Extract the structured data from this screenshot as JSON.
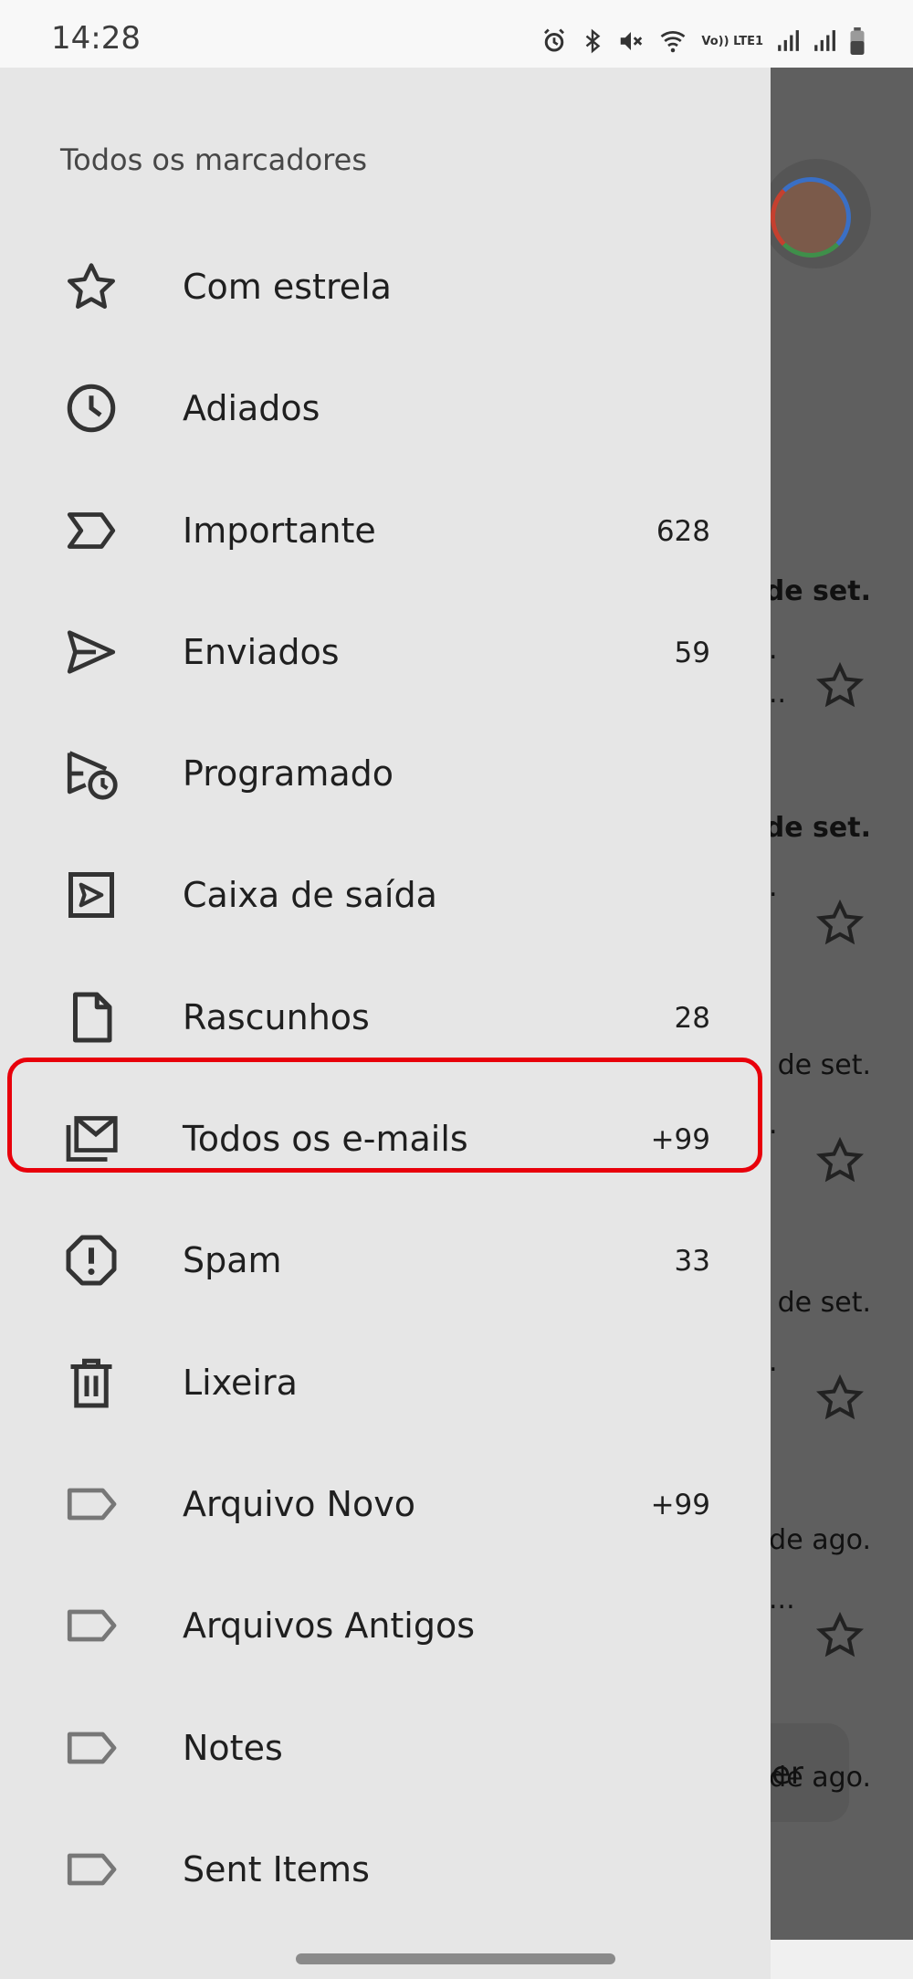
{
  "status_bar": {
    "time": "14:28",
    "icons": [
      "alarm-icon",
      "bluetooth-icon",
      "mute-icon",
      "wifi-icon",
      "volte-icon",
      "signal-icon",
      "signal-r-icon",
      "battery-icon"
    ],
    "volte_label": "Vo)) LTE1"
  },
  "drawer": {
    "heading": "Todos os marcadores",
    "items": [
      {
        "label": "Com estrela",
        "count": "",
        "icon": "star-icon"
      },
      {
        "label": "Adiados",
        "count": "",
        "icon": "clock-icon"
      },
      {
        "label": "Importante",
        "count": "628",
        "icon": "important-icon"
      },
      {
        "label": "Enviados",
        "count": "59",
        "icon": "send-icon"
      },
      {
        "label": "Programado",
        "count": "",
        "icon": "scheduled-send-icon"
      },
      {
        "label": "Caixa de saída",
        "count": "",
        "icon": "outbox-icon"
      },
      {
        "label": "Rascunhos",
        "count": "28",
        "icon": "draft-icon"
      },
      {
        "label": "Todos os e-mails",
        "count": "+99",
        "icon": "all-mail-icon"
      },
      {
        "label": "Spam",
        "count": "33",
        "icon": "spam-icon"
      },
      {
        "label": "Lixeira",
        "count": "",
        "icon": "trash-icon"
      },
      {
        "label": "Arquivo Novo",
        "count": "+99",
        "icon": "label-icon"
      },
      {
        "label": "Arquivos Antigos",
        "count": "",
        "icon": "label-icon"
      },
      {
        "label": "Notes",
        "count": "",
        "icon": "label-icon"
      },
      {
        "label": "Sent Items",
        "count": "",
        "icon": "label-icon"
      }
    ],
    "highlighted_item": "Todos os e-mails"
  },
  "background": {
    "dates": [
      "de set.",
      "de set.",
      "de set.",
      "de set.",
      "de ago.",
      "de ago."
    ],
    "snippets": [
      ".",
      "..",
      ".",
      ".",
      ".",
      "...",
      "er"
    ]
  },
  "colors": {
    "drawer_bg": "#e6e6e6",
    "scrim": "#5f5f5f",
    "highlight_border": "#e8000b",
    "text": "#1f1f1f"
  }
}
